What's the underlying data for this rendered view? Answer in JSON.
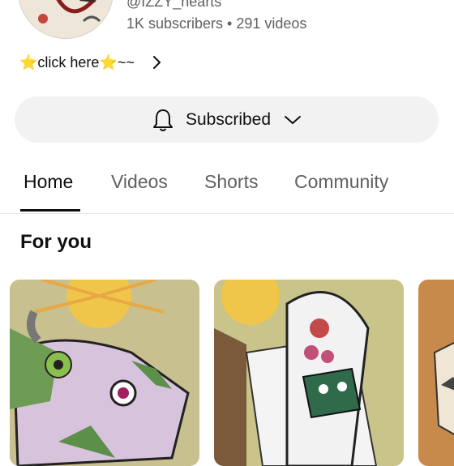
{
  "channel": {
    "handle": "@IZZY_hearts",
    "stats": "1K subscribers • 291 videos",
    "description_link": "⭐click here⭐~~"
  },
  "subscribe": {
    "label": "Subscribed",
    "icon": "bell-icon",
    "dropdown_icon": "chevron-down-icon"
  },
  "tabs": [
    {
      "label": "Home",
      "active": true
    },
    {
      "label": "Videos",
      "active": false
    },
    {
      "label": "Shorts",
      "active": false
    },
    {
      "label": "Community",
      "active": false
    }
  ],
  "section": {
    "title": "For you"
  },
  "colors": {
    "text_primary": "#0f0f0f",
    "text_secondary": "#606060",
    "button_bg": "#f2f2f2"
  }
}
